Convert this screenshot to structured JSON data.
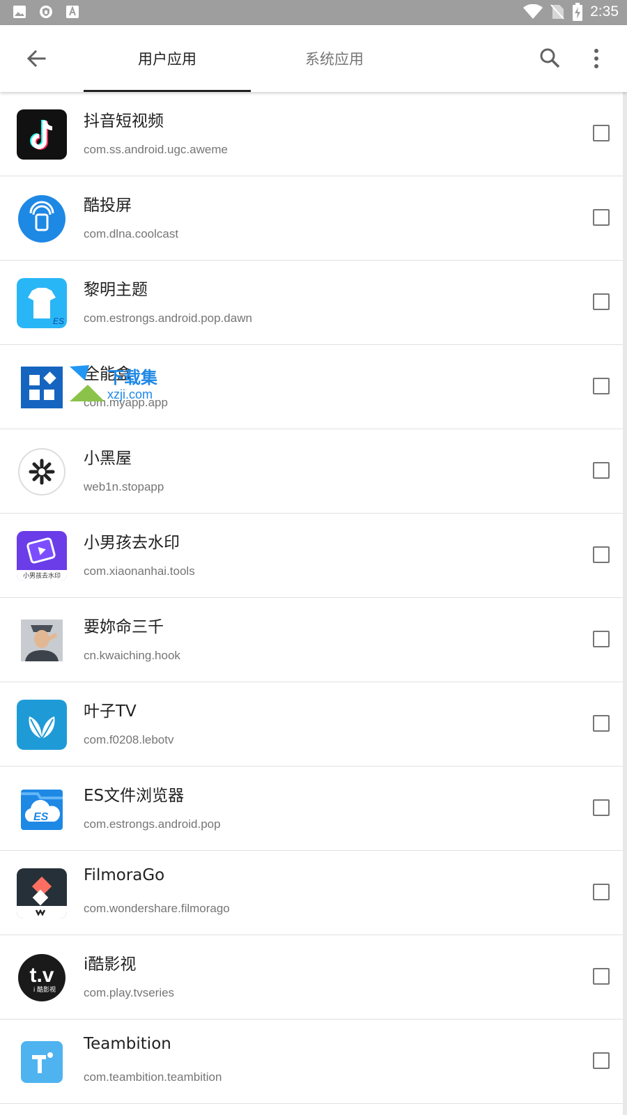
{
  "status_bar": {
    "time": "2:35",
    "left_icons": [
      "image-icon",
      "shield-icon",
      "font-icon"
    ],
    "right_icons": [
      "wifi-icon",
      "no-sim-icon",
      "battery-charging-icon"
    ]
  },
  "toolbar": {
    "tabs": [
      {
        "label": "用户应用",
        "active": true
      },
      {
        "label": "系统应用",
        "active": false
      }
    ]
  },
  "apps": [
    {
      "name": "抖音短视频",
      "package": "com.ss.android.ugc.aweme",
      "checked": false,
      "icon": "tiktok-icon"
    },
    {
      "name": "酷投屏",
      "package": "com.dlna.coolcast",
      "checked": false,
      "icon": "coolcast-icon"
    },
    {
      "name": "黎明主题",
      "package": "com.estrongs.android.pop.dawn",
      "checked": false,
      "icon": "dawn-theme-icon"
    },
    {
      "name": "全能盒",
      "package": "com.myapp.app",
      "checked": false,
      "icon": "allinone-box-icon"
    },
    {
      "name": "小黑屋",
      "package": "web1n.stopapp",
      "checked": false,
      "icon": "stopapp-icon"
    },
    {
      "name": "小男孩去水印",
      "package": "com.xiaonanhai.tools",
      "checked": false,
      "icon": "watermark-remover-icon",
      "icon_text": "小男孩去水印"
    },
    {
      "name": "要妳命三千",
      "package": "cn.kwaiching.hook",
      "checked": false,
      "icon": "hook-avatar-icon"
    },
    {
      "name": "叶子TV",
      "package": "com.f0208.lebotv",
      "checked": false,
      "icon": "leaf-tv-icon"
    },
    {
      "name": "ES文件浏览器",
      "package": "com.estrongs.android.pop",
      "checked": false,
      "icon": "es-file-explorer-icon"
    },
    {
      "name": "FilmoraGo",
      "package": "com.wondershare.filmorago",
      "checked": false,
      "icon": "filmorago-icon"
    },
    {
      "name": "i酷影视",
      "package": "com.play.tvseries",
      "checked": false,
      "icon": "ikutv-icon",
      "icon_text": "i 酷影视"
    },
    {
      "name": "Teambition",
      "package": "com.teambition.teambition",
      "checked": false,
      "icon": "teambition-icon"
    }
  ],
  "watermark": {
    "title": "下载集",
    "url": "xzji.com"
  },
  "colors": {
    "status_bar": "#9e9e9e",
    "text_primary": "#212121",
    "text_secondary": "#757575",
    "divider": "#e0e0e0"
  }
}
